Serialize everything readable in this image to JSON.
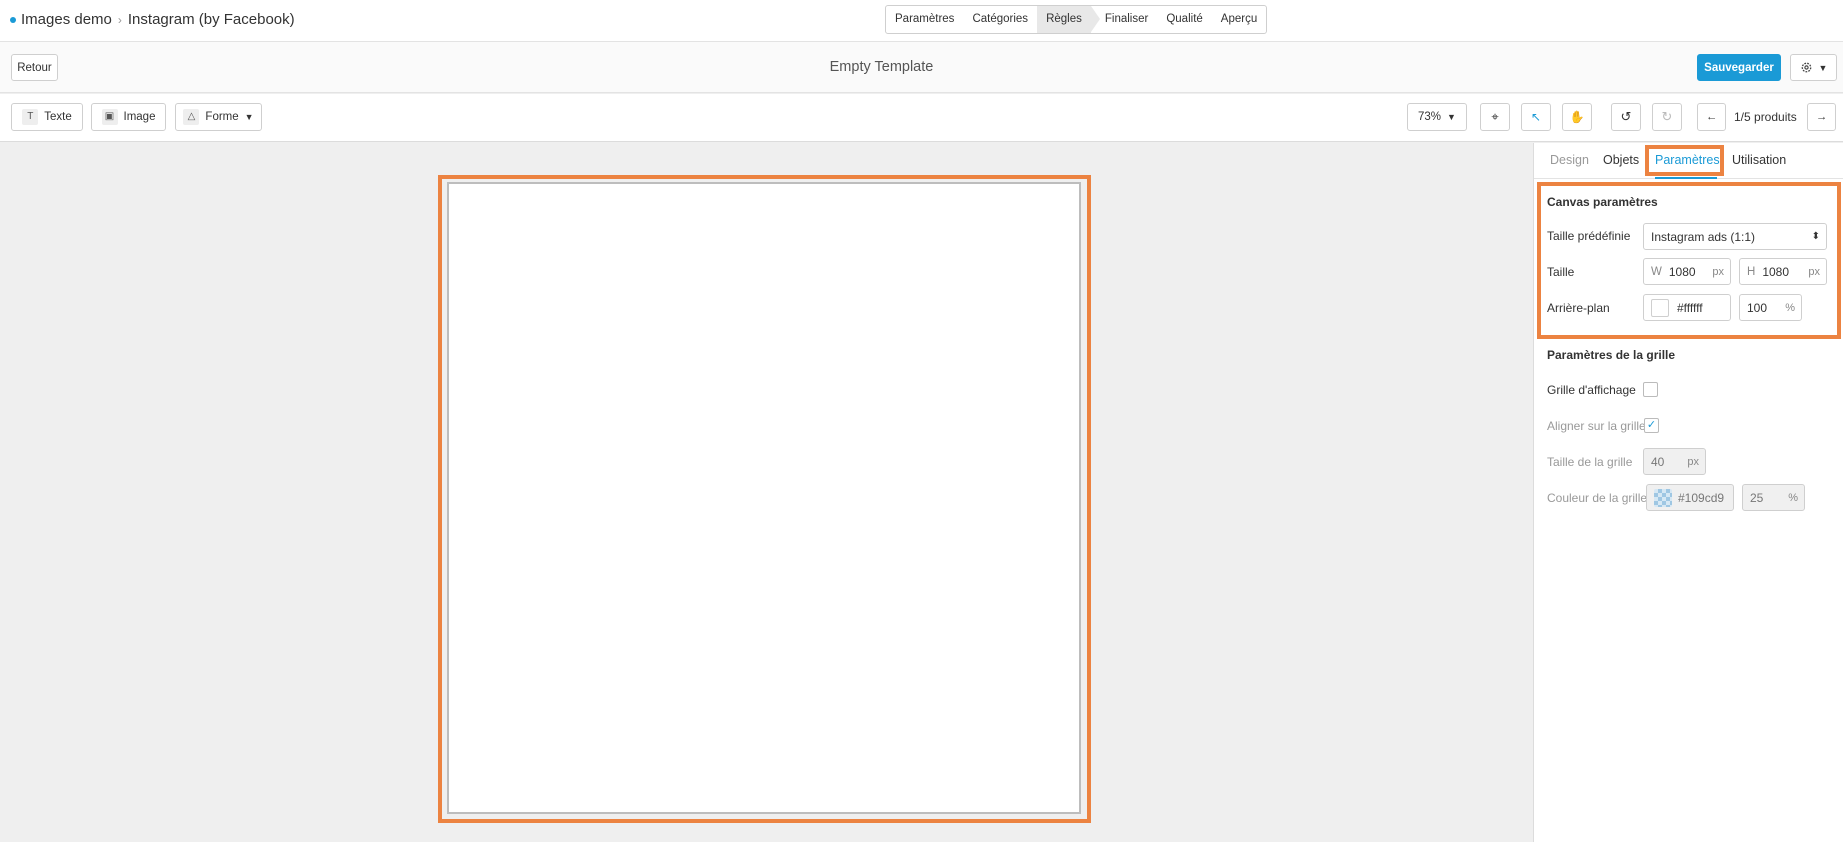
{
  "breadcrumb": {
    "project": "Images demo",
    "template": "Instagram (by Facebook)"
  },
  "steps": [
    "Paramètres",
    "Catégories",
    "Règles",
    "Finaliser",
    "Qualité",
    "Aperçu"
  ],
  "active_step": "Règles",
  "header": {
    "back_label": "Retour",
    "title": "Empty Template",
    "save_label": "Sauvegarder",
    "gear_icon": "gear-icon"
  },
  "toolbar": {
    "text_label": "Texte",
    "image_label": "Image",
    "shape_label": "Forme",
    "zoom": "73%",
    "products_label": "1/5 produits"
  },
  "panel": {
    "tabs": [
      "Design",
      "Objets",
      "Paramètres",
      "Utilisation"
    ],
    "active_tab": "Paramètres",
    "canvas_section": {
      "title": "Canvas paramètres",
      "preset_label": "Taille prédéfinie",
      "preset_value": "Instagram ads (1:1)",
      "size_label": "Taille",
      "width_prefix": "W",
      "width_value": "1080",
      "height_prefix": "H",
      "height_value": "1080",
      "unit_px": "px",
      "background_label": "Arrière-plan",
      "background_color": "#ffffff",
      "background_opacity": "100",
      "unit_percent": "%"
    },
    "grid_section": {
      "title": "Paramètres de la grille",
      "show_grid_label": "Grille d'affichage",
      "show_grid_checked": false,
      "snap_label": "Aligner sur la grille",
      "snap_checked": true,
      "grid_size_label": "Taille de la grille",
      "grid_size_value": "40",
      "grid_color_label": "Couleur de la grille",
      "grid_color_value": "#109cd9",
      "grid_opacity_value": "25"
    }
  },
  "colors": {
    "accent": "#1a9ad6",
    "highlight": "#ec8341"
  }
}
